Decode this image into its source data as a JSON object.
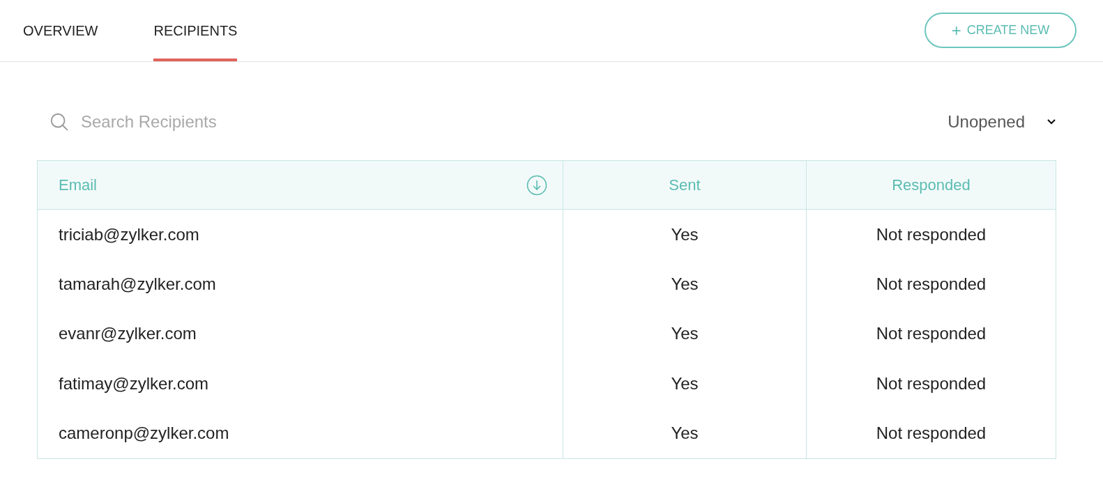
{
  "tabs": [
    {
      "label": "OVERVIEW",
      "selected": false
    },
    {
      "label": "RECIPIENTS",
      "selected": true
    }
  ],
  "create_button": {
    "icon": "+",
    "label": "CREATE NEW"
  },
  "search": {
    "placeholder": "Search Recipients"
  },
  "filter": {
    "value": "Unopened"
  },
  "table": {
    "columns": [
      {
        "label": "Email",
        "sortable": true
      },
      {
        "label": "Sent",
        "sortable": false
      },
      {
        "label": "Responded",
        "sortable": false
      }
    ],
    "rows": [
      [
        "triciab@zylker.com",
        "Yes",
        "Not responded"
      ],
      [
        "tamarah@zylker.com",
        "Yes",
        "Not responded"
      ],
      [
        "evanr@zylker.com",
        "Yes",
        "Not responded"
      ],
      [
        "fatimay@zylker.com",
        "Yes",
        "Not responded"
      ],
      [
        "cameronp@zylker.com",
        "Yes",
        "Not responded"
      ]
    ]
  }
}
